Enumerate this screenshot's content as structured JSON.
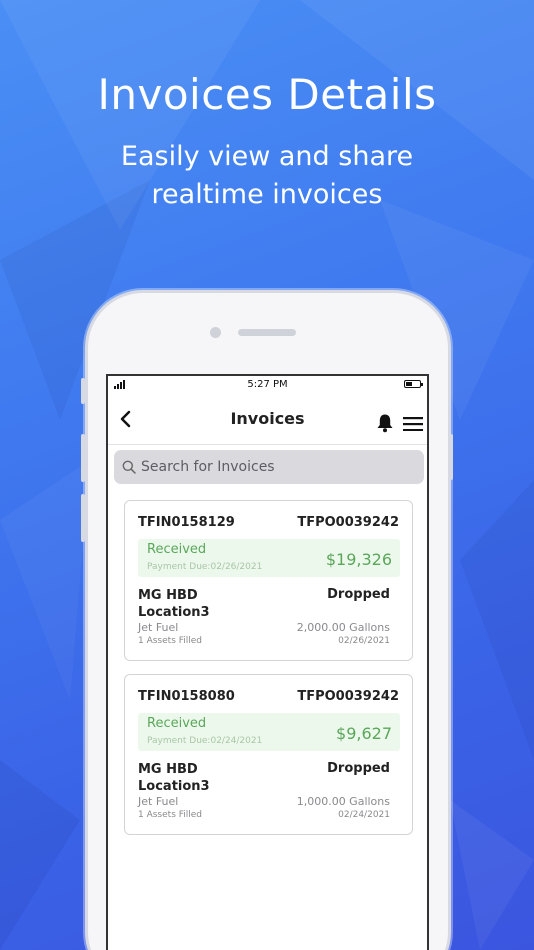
{
  "promo": {
    "title": "Invoices Details",
    "subtitle_line1": "Easily view and share",
    "subtitle_line2": "realtime invoices"
  },
  "statusbar": {
    "time": "5:27 PM"
  },
  "navbar": {
    "title": "Invoices",
    "back_icon": "chevron-left-icon",
    "bell_icon": "bell-icon",
    "menu_icon": "hamburger-menu-icon"
  },
  "search": {
    "placeholder": "Search for Invoices",
    "icon": "search-icon"
  },
  "colors": {
    "status_green": "#5aa75a",
    "status_bg": "#edf8ec",
    "background_blue": "#3f78ef"
  },
  "invoices": [
    {
      "invoice_id": "TFIN0158129",
      "po_number": "TFPO0039242",
      "status": "Received",
      "payment_due": "Payment Due:02/26/2021",
      "amount": "$19,326",
      "location_line1": "MG HBD",
      "location_line2": "Location3",
      "delivery_status": "Dropped",
      "fuel_type": "Jet Fuel",
      "gallons": "2,000.00 Gallons",
      "assets": "1 Assets Filled",
      "date": "02/26/2021"
    },
    {
      "invoice_id": "TFIN0158080",
      "po_number": "TFPO0039242",
      "status": "Received",
      "payment_due": "Payment Due:02/24/2021",
      "amount": "$9,627",
      "location_line1": "MG HBD",
      "location_line2": "Location3",
      "delivery_status": "Dropped",
      "fuel_type": "Jet Fuel",
      "gallons": "1,000.00 Gallons",
      "assets": "1 Assets Filled",
      "date": "02/24/2021"
    }
  ]
}
